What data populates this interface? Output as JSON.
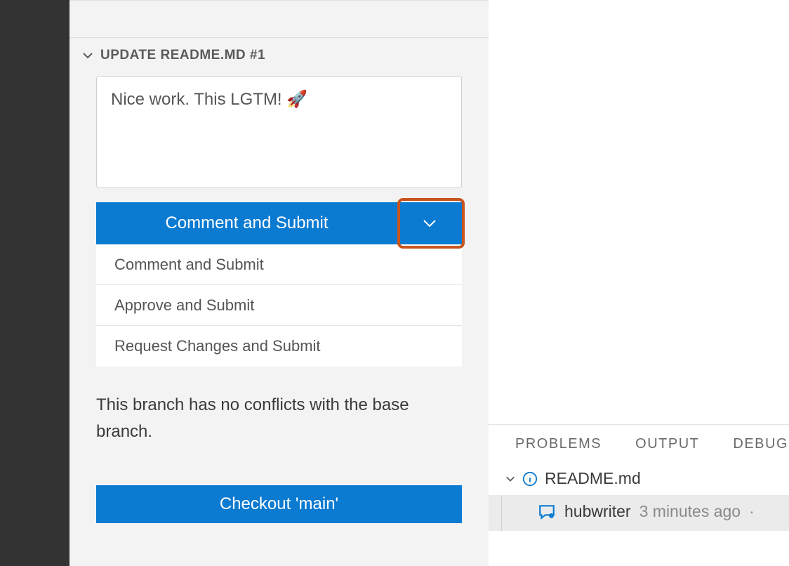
{
  "pr": {
    "title": "UPDATE README.MD #1",
    "comment_value": "Nice work. This LGTM! 🚀",
    "primary_button_label": "Comment and Submit",
    "options": [
      "Comment and Submit",
      "Approve and Submit",
      "Request Changes and Submit"
    ],
    "conflict_message": "This branch has no conflicts with the base branch.",
    "checkout_label": "Checkout 'main'"
  },
  "panel": {
    "tabs": [
      "PROBLEMS",
      "OUTPUT",
      "DEBUG"
    ],
    "file_label": "README.md",
    "item_user": "hubwriter",
    "item_time": "3 minutes ago",
    "trailing_dot": "·"
  },
  "colors": {
    "accent": "#0b7ad1",
    "highlight_border": "#c8551e"
  }
}
